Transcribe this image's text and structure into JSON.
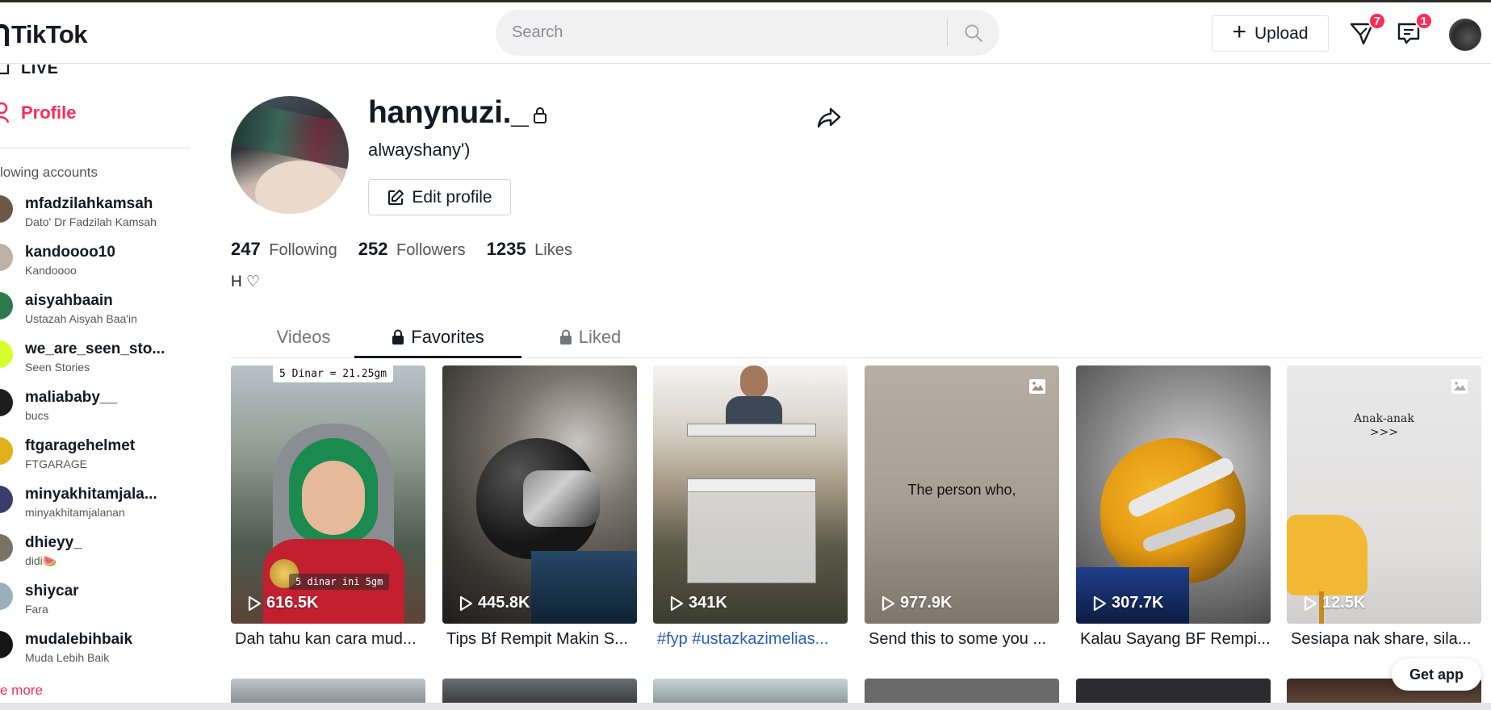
{
  "header": {
    "logo_text": "TikTok",
    "search_placeholder": "Search",
    "upload_label": "Upload",
    "inbox_badge": "7",
    "messages_badge": "1"
  },
  "sidebar": {
    "live_label": "LIVE",
    "profile_label": "Profile",
    "following_heading": "lowing accounts",
    "accounts": [
      {
        "username": "mfadzilahkamsah",
        "name": "Dato' Dr Fadzilah Kamsah",
        "color": "#6b5a4a"
      },
      {
        "username": "kandoooo10",
        "name": "Kandoooo",
        "color": "#bfb1a6"
      },
      {
        "username": "aisyahbaain",
        "name": "Ustazah Aisyah Baa'in",
        "color": "#2e7a4c"
      },
      {
        "username": "we_are_seen_sto...",
        "name": "Seen Stories",
        "color": "#d6ff2e"
      },
      {
        "username": "maliababy__",
        "name": "bucs",
        "color": "#1d1d1d"
      },
      {
        "username": "ftgaragehelmet",
        "name": "FTGARAGE",
        "color": "#e2b11a"
      },
      {
        "username": "minyakhitamjala...",
        "name": "minyakhitamjalanan",
        "color": "#3a3d6a"
      },
      {
        "username": "dhieyy_",
        "name": "didi🍉",
        "color": "#7b7266"
      },
      {
        "username": "shiycar",
        "name": "Fara",
        "color": "#9ab0b8"
      },
      {
        "username": "mudalebihbaik",
        "name": "Muda Lebih Baik",
        "color": "#141414"
      }
    ],
    "see_more": "e more"
  },
  "profile": {
    "username": "hanynuzi._",
    "display_name": "alwayshany')",
    "edit_label": "Edit profile",
    "following_count": "247",
    "following_label": "Following",
    "followers_count": "252",
    "followers_label": "Followers",
    "likes_count": "1235",
    "likes_label": "Likes",
    "bio": "H ♡"
  },
  "tabs": {
    "videos": "Videos",
    "favorites": "Favorites",
    "liked": "Liked"
  },
  "videos": [
    {
      "views": "616.5K",
      "caption": "Dah tahu kan cara mud...",
      "overlay_top": "5 Dinar = 21.25gm",
      "overlay_mid": "5 dinar ini 5gm"
    },
    {
      "views": "445.8K",
      "caption": "Tips Bf Rempit Makin S..."
    },
    {
      "views": "341K",
      "caption": "#fyp #ustazkazimelias..."
    },
    {
      "views": "977.9K",
      "caption": "Send this to some you ...",
      "overlay_text": "The person who,"
    },
    {
      "views": "307.7K",
      "caption": "Kalau Sayang BF Rempi..."
    },
    {
      "views": "12.5K",
      "caption": "Sesiapa nak share, sila...",
      "overlay_title": "Anak-anak",
      "overlay_arrows": ">>>"
    }
  ],
  "get_app": "Get app",
  "colors": {
    "accent": "#fe2c55",
    "text": "#161823",
    "hashtag": "#2b5db9"
  }
}
